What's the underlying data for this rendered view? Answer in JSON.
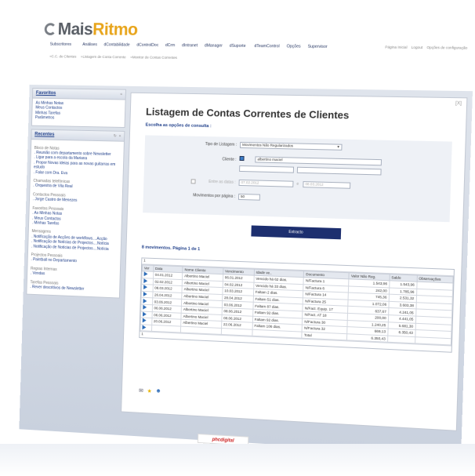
{
  "header": {
    "logo_prefix": "Mais",
    "logo_accent": "Ritmo",
    "topnav": [
      "Subscritores",
      "Análises",
      "dContabilidade",
      "dControlDoc",
      "dCrm",
      "dIntranet",
      "dManager",
      "dSuporte",
      "dTeamControl",
      "Opções",
      "Supervisor"
    ],
    "toplinks": [
      "Página Inicial",
      "Logout",
      "Opções de configuração"
    ],
    "breadcrumb": [
      "»C.C. de Clientes",
      "»Listagem de Conta Corrente",
      "»Monitor de Contas Correntes"
    ]
  },
  "sidebar": {
    "favoritos": {
      "title": "Favoritos",
      "items": [
        "As Minhas Notas",
        "Meus Contactos",
        "Minhas Tarefas",
        "Parâmetros"
      ]
    },
    "recentes": {
      "title": "Recentes",
      "sections": [
        {
          "title": "Bloco de Notas",
          "items": [
            ". Reunião com departamento sobre Newsletter",
            ". Ligar para a escola da Mariana",
            ". Propor Novas ideias para as novas guitarras em estudo",
            ". Falar com Dra. Eva"
          ]
        },
        {
          "title": "Chamadas telefónicas",
          "items": [
            ". Orquestra de Vila Real"
          ]
        },
        {
          "title": "Contactos Pessoais",
          "items": [
            ". Jorge Castro de Menezes"
          ]
        },
        {
          "title": "Favoritos Pessoais",
          "items": [
            ". As Minhas Notas",
            ". Meus Contactos",
            ". Minhas Tarefas"
          ]
        },
        {
          "title": "Mensagens",
          "items": [
            ". Notificação de Acções de workflows....Acção",
            ". Notificação de Notícias de Projectos....Notícia",
            ". Notificação de Notícias de Projectos....Notícia"
          ]
        },
        {
          "title": "Projectos Pessoais",
          "items": [
            ". Paintball no Departamento"
          ]
        },
        {
          "title": "Regras Internas",
          "items": [
            ". Vendas"
          ]
        },
        {
          "title": "Tarefas Pessoais",
          "items": [
            ". Rever descritivos de Newsletter"
          ]
        }
      ]
    }
  },
  "main": {
    "close": "[X]",
    "title": "Listagem de Contas Correntes de Clientes",
    "subtitle": "Escolha as opções de consulta :",
    "form": {
      "tipo_label": "Tipo de Listagem :",
      "tipo_value": "Movimentos Não Regularizados",
      "cliente_label": "Cliente :",
      "cliente_value": "albertino maciel",
      "datas_label": "Entre as datas :",
      "date_from": "07.02.2012",
      "date_sep": "e",
      "date_to": "08.03.2012",
      "mov_label": "Movimentos por página :",
      "mov_value": "50"
    },
    "extract_label": "Extracto",
    "count_text": "8 movimentos. Página 1 de 1",
    "pager_top": "1",
    "pager_bottom": "1",
    "table": {
      "headers": [
        "Ver",
        "Data",
        "Nome Cliente",
        "Vencimento",
        "Idade ve..",
        "Documento",
        "Valor Não Reg.",
        "Saldo",
        "Observações"
      ],
      "rows": [
        [
          "04.01.2012",
          "Albertino Maciel",
          "06.01.2012",
          "Vencido há 62 dias.",
          "N/Factura 1",
          "1.543,96",
          "1.543,96",
          ""
        ],
        [
          "02.02.2012",
          "Albertino Maciel",
          "04.02.2012",
          "Vencido há 33 dias.",
          "N/Factura 6",
          "242,00",
          "1.785,96",
          ""
        ],
        [
          "08.03.2012",
          "Albertino Maciel",
          "10.03.2012",
          "Faltam 2 dias.",
          "N/Factura 14",
          "745,36",
          "2.531,32",
          ""
        ],
        [
          "26.04.2012",
          "Albertino Maciel",
          "28.04.2012",
          "Faltam 51 dias.",
          "N/Factura 25",
          "1.072,06",
          "3.603,38",
          ""
        ],
        [
          "03.05.2012",
          "Albertino Maciel",
          "03.06.2012",
          "Faltam 87 dias.",
          "N/Fact. Equip. 17",
          "637,67",
          "4.241,05",
          ""
        ],
        [
          "06.06.2012",
          "Albertino Maciel",
          "08.06.2012",
          "Faltam 92 dias.",
          "N/Fact. AT 18",
          "200,00",
          "4.441,05",
          ""
        ],
        [
          "06.06.2012",
          "Albertino Maciel",
          "08.06.2012",
          "Faltam 92 dias.",
          "N/Factura 30",
          "1.240,25",
          "5.681,30",
          ""
        ],
        [
          "20.06.2012",
          "Albertino Maciel",
          "22.06.2012",
          "Faltam 106 dias.",
          "N/Factura 32",
          "669,13",
          "6.350,43",
          ""
        ]
      ],
      "total_label": "Total",
      "total_value": "6.350,43"
    },
    "footer_brand": "phcdigital"
  }
}
